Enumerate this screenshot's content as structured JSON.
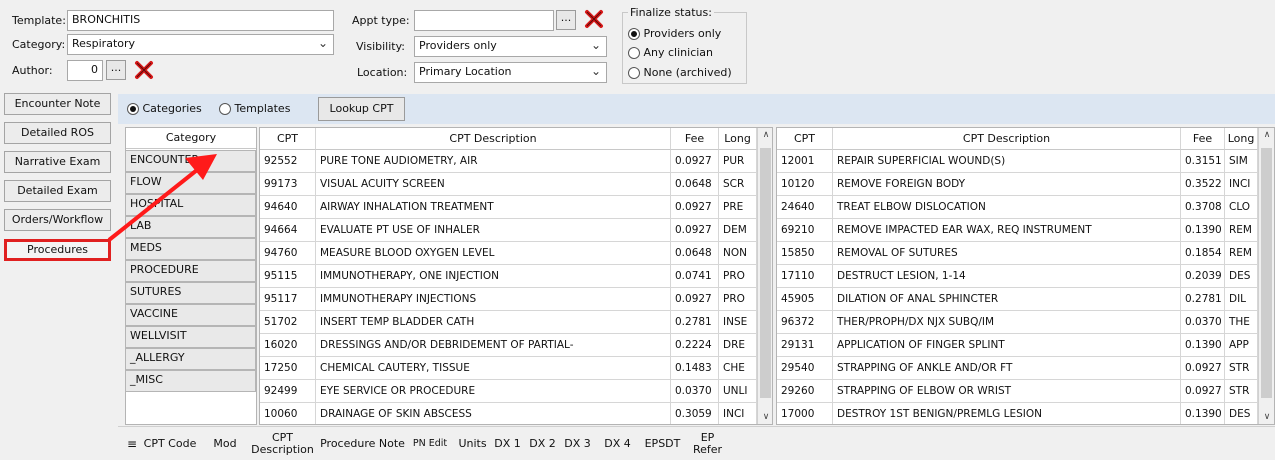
{
  "header": {
    "template_label": "Template:",
    "template_value": "BRONCHITIS",
    "category_label": "Category:",
    "category_value": "Respiratory",
    "author_label": "Author:",
    "author_value": "0",
    "appt_type_label": "Appt type:",
    "appt_type_value": "",
    "visibility_label": "Visibility:",
    "visibility_value": "Providers only",
    "location_label": "Location:",
    "location_value": "Primary Location",
    "dots_label": "...",
    "finalize_title": "Finalize status:",
    "finalize_options": [
      "Providers only",
      "Any clinician",
      "None (archived)"
    ]
  },
  "left_nav": [
    "Encounter Note",
    "Detailed ROS",
    "Narrative Exam",
    "Detailed Exam",
    "Orders/Workflow",
    "Procedures"
  ],
  "toolbar": {
    "categories_label": "Categories",
    "templates_label": "Templates",
    "lookup_label": "Lookup CPT"
  },
  "category_panel": {
    "header": "Category",
    "items": [
      "ENCOUNTER",
      "FLOW",
      "HOSPITAL",
      "LAB",
      "MEDS",
      "PROCEDURE",
      "SUTURES",
      "VACCINE",
      "WELLVISIT",
      "_ALLERGY",
      "_MISC"
    ]
  },
  "cpt_columns": [
    "CPT",
    "CPT Description",
    "Fee",
    "Long"
  ],
  "cpt_left": [
    [
      "92552",
      "PURE TONE AUDIOMETRY, AIR",
      "0.0927",
      "PUR"
    ],
    [
      "99173",
      "VISUAL ACUITY SCREEN",
      "0.0648",
      "SCR"
    ],
    [
      "94640",
      "AIRWAY INHALATION TREATMENT",
      "0.0927",
      "PRE"
    ],
    [
      "94664",
      "EVALUATE PT USE OF INHALER",
      "0.0927",
      "DEM"
    ],
    [
      "94760",
      "MEASURE BLOOD OXYGEN LEVEL",
      "0.0648",
      "NON"
    ],
    [
      "95115",
      "IMMUNOTHERAPY, ONE INJECTION",
      "0.0741",
      "PRO"
    ],
    [
      "95117",
      "IMMUNOTHERAPY INJECTIONS",
      "0.0927",
      "PRO"
    ],
    [
      "51702",
      "INSERT TEMP BLADDER CATH",
      "0.2781",
      "INSE"
    ],
    [
      "16020",
      "DRESSINGS AND/OR DEBRIDEMENT OF PARTIAL-",
      "0.2224",
      "DRE"
    ],
    [
      "17250",
      "CHEMICAL CAUTERY, TISSUE",
      "0.1483",
      "CHE"
    ],
    [
      "92499",
      "EYE SERVICE OR PROCEDURE",
      "0.0370",
      "UNLI"
    ],
    [
      "10060",
      "DRAINAGE OF SKIN ABSCESS",
      "0.3059",
      "INCI"
    ]
  ],
  "cpt_right": [
    [
      "12001",
      "REPAIR SUPERFICIAL WOUND(S)",
      "0.3151",
      "SIM"
    ],
    [
      "10120",
      "REMOVE FOREIGN BODY",
      "0.3522",
      "INCI"
    ],
    [
      "24640",
      "TREAT ELBOW DISLOCATION",
      "0.3708",
      "CLO"
    ],
    [
      "69210",
      "REMOVE IMPACTED EAR WAX, REQ INSTRUMENT",
      "0.1390",
      "REM"
    ],
    [
      "15850",
      "REMOVAL OF SUTURES",
      "0.1854",
      "REM"
    ],
    [
      "17110",
      "DESTRUCT LESION, 1-14",
      "0.2039",
      "DES"
    ],
    [
      "45905",
      "DILATION OF ANAL SPHINCTER",
      "0.2781",
      "DIL"
    ],
    [
      "96372",
      "THER/PROPH/DX NJX SUBQ/IM",
      "0.0370",
      "THE"
    ],
    [
      "29131",
      "APPLICATION OF FINGER SPLINT",
      "0.1390",
      "APP"
    ],
    [
      "29540",
      "STRAPPING OF ANKLE AND/OR FT",
      "0.0927",
      "STR"
    ],
    [
      "29260",
      "STRAPPING OF ELBOW OR WRIST",
      "0.0927",
      "STR"
    ],
    [
      "17000",
      "DESTROY 1ST BENIGN/PREMLG LESION",
      "0.1390",
      "DES"
    ]
  ],
  "bottom_columns": [
    "CPT Code",
    "Mod",
    "CPT Description",
    "Procedure Note",
    "PN Edit",
    "Units",
    "DX 1",
    "DX 2",
    "DX 3",
    "DX 4",
    "EPSDT",
    "EP Refer"
  ]
}
